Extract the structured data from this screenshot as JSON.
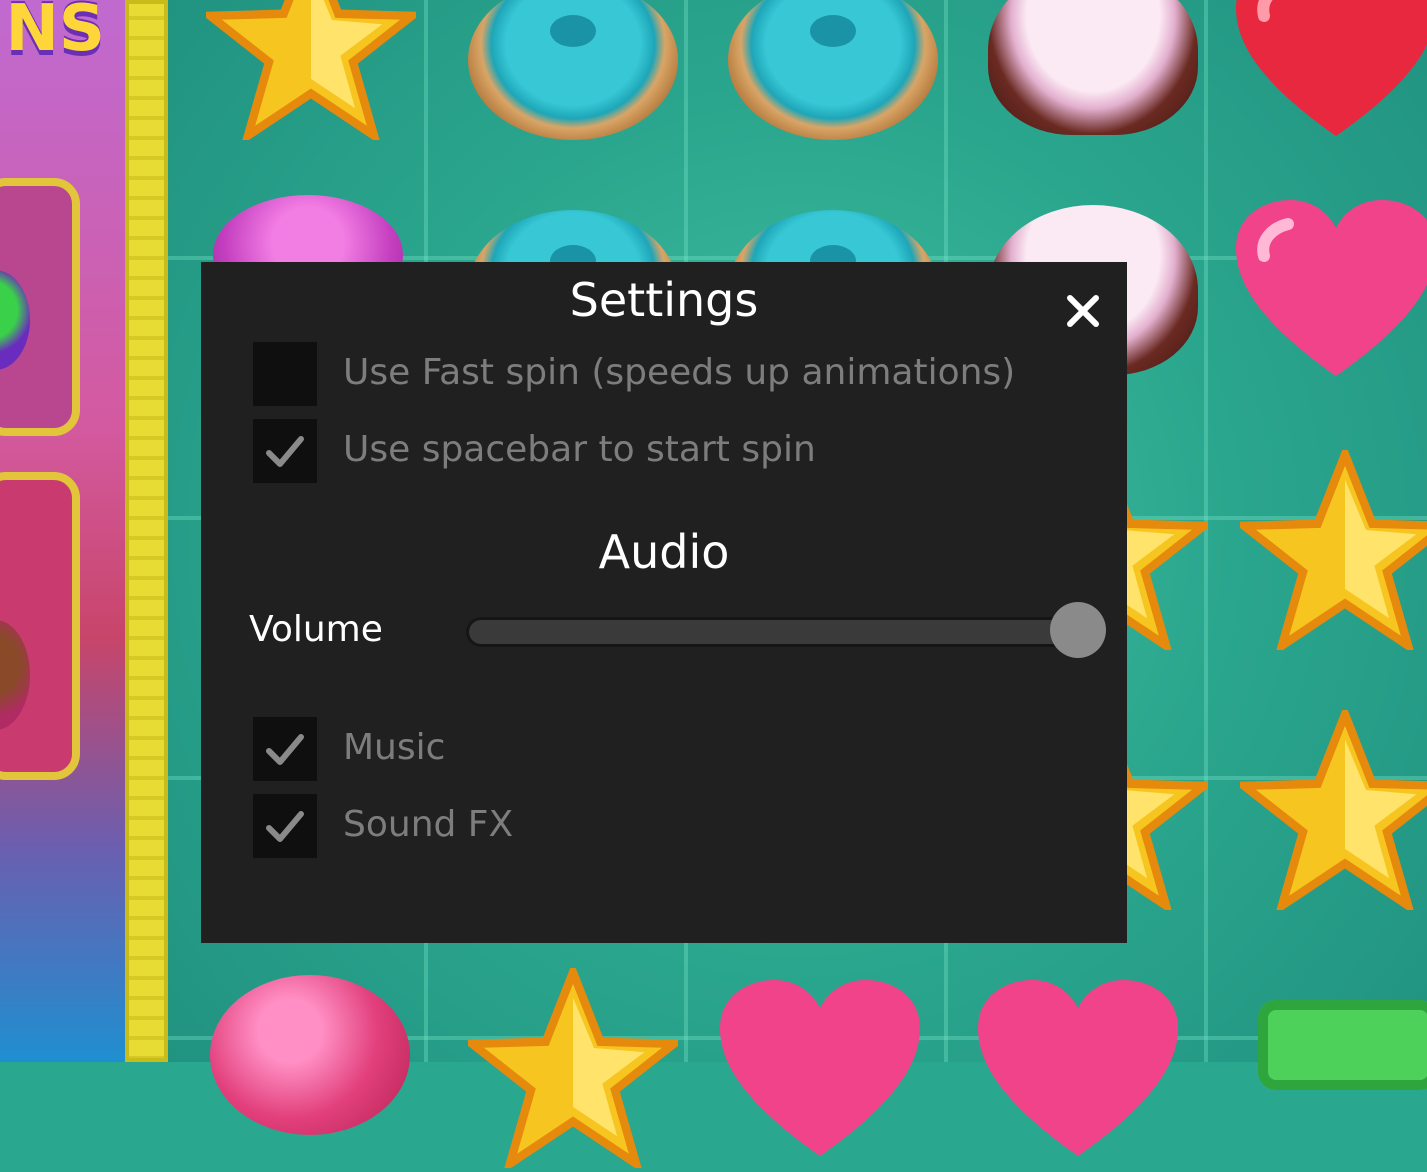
{
  "game": {
    "logo_fragment": "NS"
  },
  "settings": {
    "title": "Settings",
    "close_icon": "close-icon",
    "options": [
      {
        "label": "Use Fast spin (speeds up animations)",
        "checked": false
      },
      {
        "label": "Use spacebar to start spin",
        "checked": true
      }
    ],
    "audio": {
      "heading": "Audio",
      "volume_label": "Volume",
      "volume_level": 1.0,
      "toggles": [
        {
          "label": "Music",
          "checked": true
        },
        {
          "label": "Sound FX",
          "checked": true
        }
      ]
    }
  },
  "colors": {
    "dialog_bg": "#202020",
    "checkbox_bg": "#0f0f0f",
    "muted_text": "#7d7d7d",
    "game_bg": "#2aa78f",
    "rail": "#e6dc33"
  }
}
